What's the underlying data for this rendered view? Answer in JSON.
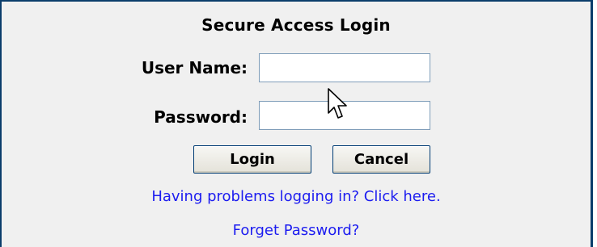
{
  "login_form": {
    "title": "Secure Access Login",
    "username_label": "User Name:",
    "username_value": "",
    "password_label": "Password:",
    "password_value": "",
    "login_button": "Login",
    "cancel_button": "Cancel",
    "problems_link": "Having problems logging in? Click here.",
    "forgot_link": "Forget Password?"
  },
  "colors": {
    "border": "#0a3d6b",
    "panel_background": "#f0f0f0",
    "link": "#1c1cf0"
  },
  "icons": {
    "cursor": "mouse-pointer-icon"
  }
}
